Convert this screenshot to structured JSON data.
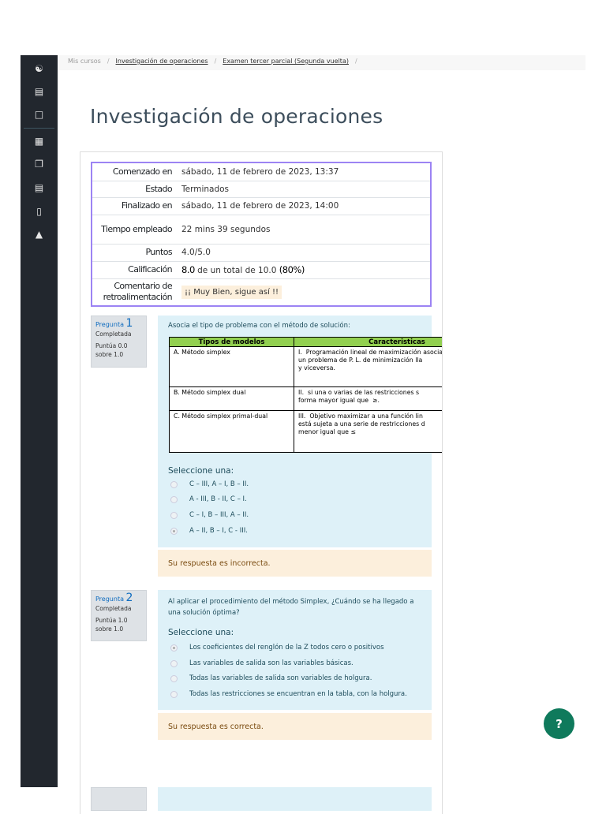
{
  "sidebar": {
    "icons": [
      "user-icon",
      "book-icon",
      "folder-icon",
      "calendar-icon",
      "copy-icon",
      "book-open-icon",
      "mobile-icon",
      "graduation-cap-icon"
    ]
  },
  "breadcrumb": {
    "items": [
      "Mis cursos",
      "Investigación de operaciones",
      "Examen tercer parcial (Segunda vuelta)"
    ],
    "separator": "/"
  },
  "page_title": "Investigación de operaciones",
  "summary": {
    "rows": [
      {
        "label": "Comenzado en",
        "value": "sábado, 11 de febrero de 2023, 13:37"
      },
      {
        "label": "Estado",
        "value": "Terminados"
      },
      {
        "label": "Finalizado en",
        "value": "sábado, 11 de febrero de 2023, 14:00"
      },
      {
        "label": "Tiempo empleado",
        "value": "22 mins 39 segundos"
      },
      {
        "label": "Puntos",
        "value": "4.0/5.0"
      },
      {
        "label": "Calificación",
        "value_bold": "8.0",
        "value": " de un total de 10.0 ",
        "value_pct": "(80%)"
      },
      {
        "label": "Comentario de retroalimentación",
        "value": "¡¡ Muy Bien, sigue así !!"
      }
    ]
  },
  "questions": [
    {
      "label": "Pregunta",
      "number": "1",
      "state": "Completada",
      "score": "Puntúa 0.0 sobre 1.0",
      "text": "Asocia el tipo de problema con el método de solución:",
      "table": {
        "headers": [
          "Tipos de modelos",
          "Caracteristicas"
        ],
        "rows": [
          [
            "A. Método simplex",
            "I.  Programación lineal de maximización asociado\nun problema de P. L. de minimización lla\ny viceversa."
          ],
          [
            "B.  Método simplex dual",
            "II.  si una o varias de las restricciones s\nforma mayor igual que  ≥."
          ],
          [
            "C.  Método simplex primal-dual",
            "III.  Objetivo maximizar a una función lin\nestá sujeta a una serie de restricciones d\nmenor igual que ≤"
          ]
        ]
      },
      "prompt": "Seleccione una:",
      "options": [
        "C – III, A – I, B – II.",
        "A - III,  B - II, C – I.",
        "C – I, B – III, A – II.",
        "A – II, B – I, C - III."
      ],
      "selected": 3,
      "feedback": "Su respuesta es incorrecta."
    },
    {
      "label": "Pregunta",
      "number": "2",
      "state": "Completada",
      "score": "Puntúa 1.0 sobre 1.0",
      "text": "Al aplicar el procedimiento del método Simplex, ¿Cuándo se ha llegado a una solución óptima?",
      "prompt": "Seleccione una:",
      "options": [
        "Los coeficientes del renglón de la Z todos cero o positivos",
        "Las variables de salida son las variables básicas.",
        "Todas las variables de salida son variables de holgura.",
        "Todas las restricciones se encuentran en la tabla, con la holgura."
      ],
      "selected": 0,
      "feedback": "Su respuesta es correcta."
    }
  ],
  "help_button": "?"
}
